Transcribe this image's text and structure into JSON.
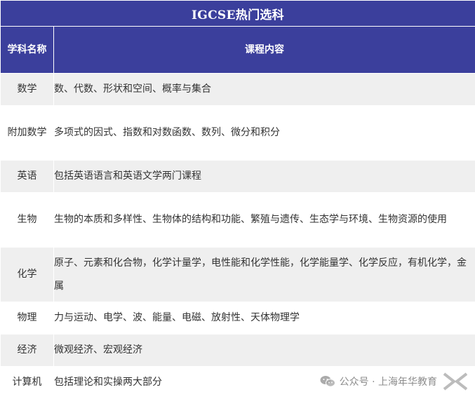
{
  "title": "IGCSE热门选科",
  "header": {
    "subject": "学科名称",
    "content": "课程内容"
  },
  "rows": [
    {
      "subject": "数学",
      "content": "数、代数、形状和空间、概率与集合"
    },
    {
      "subject": "附加数学",
      "content": "多项式的因式、指数和对数函数、数列、微分和积分"
    },
    {
      "subject": "英语",
      "content": "包括英语语言和英语文学两门课程"
    },
    {
      "subject": "生物",
      "content": "生物的本质和多样性、生物体的结构和功能、繁殖与遗传、生态学与环境、生物资源的使用"
    },
    {
      "subject": "化学",
      "content": "原子、元素和化合物，化学计量学，电性能和化学性能，化学能量学、化学反应，有机化学，金属"
    },
    {
      "subject": "物理",
      "content": "力与运动、电学、波、能量、电磁、放射性、天体物理学"
    },
    {
      "subject": "经济",
      "content": "微观经济、宏观经济"
    },
    {
      "subject": "计算机",
      "content": "包括理论和实操两大部分"
    }
  ],
  "watermark": {
    "text": "公众号 · 上海年华教育",
    "icon": "wechat-icon",
    "brand": "X NEW logo"
  },
  "colors": {
    "header_bg": "#3b3f9c",
    "row_alt_bg": "#efefef",
    "text": "#333333"
  }
}
